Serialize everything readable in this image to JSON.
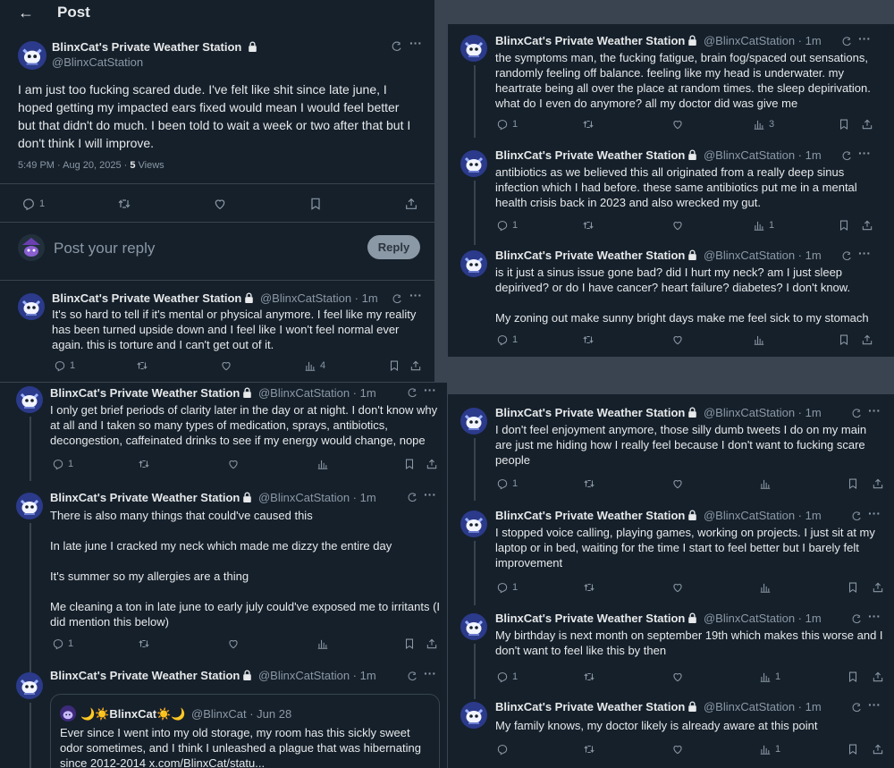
{
  "header": {
    "back_label": "←",
    "title": "Post"
  },
  "author": {
    "name": "BlinxCat's Private Weather Station",
    "handle": "@BlinxCatStation",
    "time": "1m"
  },
  "main_post": {
    "text": "I am just too fucking scared dude. I've felt like shit since late june, I hoped getting my impacted ears fixed would mean I would feel better but that didn't do much. I been told to wait a week or two after that but I don't think I will improve.",
    "timestamp": "5:49 PM · Aug 20, 2025 · ",
    "views_count": "5",
    "views_label": " Views",
    "replies": "1"
  },
  "reply_box": {
    "placeholder": "Post your reply",
    "button": "Reply"
  },
  "left_posts": [
    {
      "lines": [
        "It's so hard to tell if it's mental or physical anymore. I feel like my reality has been turned upside down and I feel like I won't feel normal ever again. this is torture and I can't get out of it."
      ],
      "replies": "1",
      "views": "4"
    },
    {
      "lines": [
        "I only get brief periods of clarity later in the day or at night. I don't know why at all and I taken so many types of medication, sprays, antibiotics, decongestion, caffeinated drinks to see if my energy would change, nope"
      ],
      "replies": "1",
      "views": ""
    },
    {
      "lines": [
        "There is also many things that could've caused this",
        "In late june I cracked my neck which made me dizzy the entire day",
        "It's summer so my allergies are a thing",
        "Me cleaning a ton in late june to early july could've exposed me to irritants (I did mention this below)"
      ],
      "replies": "1",
      "views": ""
    }
  ],
  "quote": {
    "name": "🌙☀️BlinxCat☀️🌙",
    "handle": "@BlinxCat · Jun 28",
    "text": "Ever since I went into my old storage, my room has this sickly sweet odor sometimes, and I think I unleashed a plague that was hibernating since 2012-2014 x.com/BlinxCat/statu..."
  },
  "right_posts": [
    {
      "lines": [
        "the symptoms man, the fucking fatigue, brain fog/spaced out sensations, randomly feeling off balance. feeling like my head is underwater. my heartrate being all over the place at random times. the sleep depirivation. what do I even do anymore? all my doctor did was give me"
      ],
      "replies": "1",
      "views": "3"
    },
    {
      "lines": [
        "antibiotics as we believed this all originated from a really deep sinus infection which I had before. these same antibiotics put me in a mental health crisis back in 2023 and also wrecked my gut."
      ],
      "replies": "1",
      "views": "1"
    },
    {
      "lines": [
        "is it just a sinus issue gone bad? did I hurt my neck? am I just sleep depirived? or do I have cancer? heart failure? diabetes? I don't know.",
        "My zoning out make sunny bright days make me feel sick to my stomach"
      ],
      "replies": "1",
      "views": ""
    },
    {
      "lines": [
        "I don't feel enjoyment anymore, those silly dumb tweets I do on my main are just me hiding how I really feel because I don't want to fucking scare people"
      ],
      "replies": "1",
      "views": ""
    },
    {
      "lines": [
        "I stopped voice calling, playing games, working on projects. I just sit at my laptop or in bed, waiting for the time I start to feel better but I barely felt improvement"
      ],
      "replies": "1",
      "views": ""
    },
    {
      "lines": [
        "My birthday is next month on september 19th which makes this worse and I don't want to feel like this by then"
      ],
      "replies": "1",
      "views": "1"
    },
    {
      "lines": [
        "My family knows, my doctor likely is already aware at this point"
      ],
      "replies": "",
      "views": "1"
    }
  ],
  "colors": {
    "bg": "#15202b",
    "text": "#e7e9ea",
    "muted": "#8b98a5",
    "border": "#38444d",
    "gap": "#3a4451"
  }
}
